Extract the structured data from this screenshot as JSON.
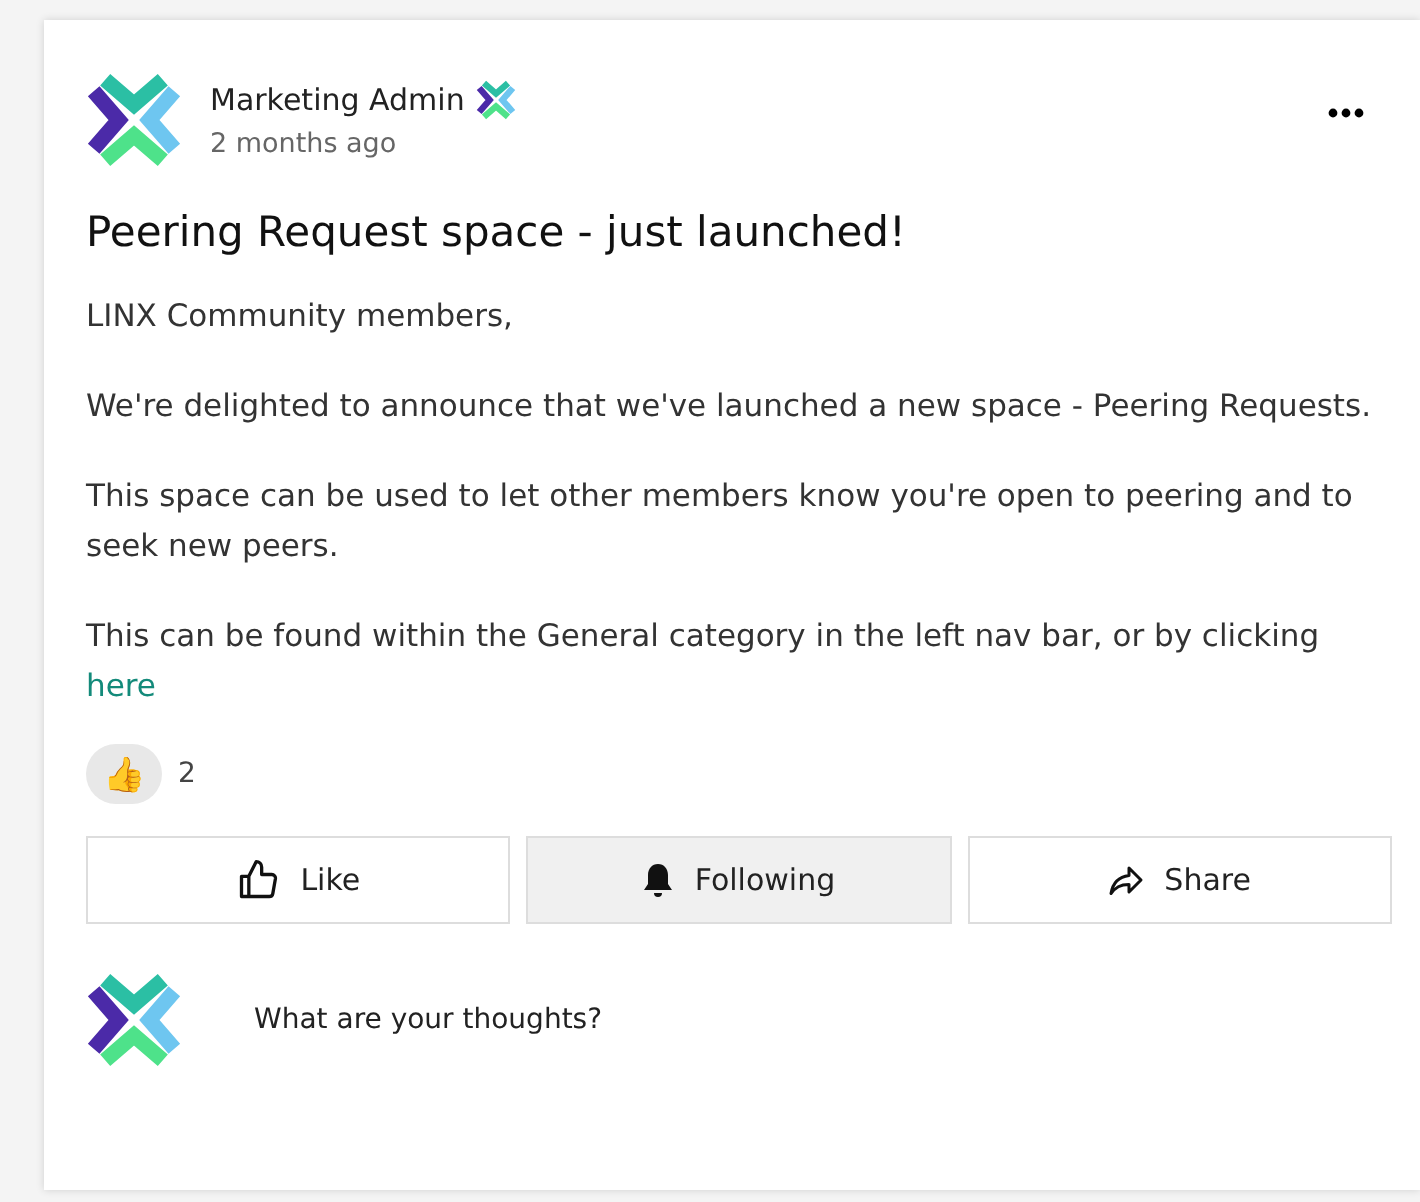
{
  "post": {
    "author": "Marketing Admin",
    "time": "2 months ago",
    "title": "Peering Request space - just launched!",
    "paragraphs": [
      {
        "text": "LINX Community members,"
      },
      {
        "text": "We're delighted to announce that we've launched a new space - Peering Requests."
      },
      {
        "text": "This space can be used to let other members know you're open to peering and to seek new peers."
      },
      {
        "text": "This can be found within the General category in the left nav bar, or by clicking",
        "link": "here"
      }
    ],
    "reactions": [
      {
        "emoji": "👍",
        "count": "2"
      }
    ],
    "actions": [
      {
        "kind": "like",
        "label": "Like",
        "selected": false
      },
      {
        "kind": "follow",
        "label": "Following",
        "selected": true
      },
      {
        "kind": "share",
        "label": "Share",
        "selected": false
      }
    ],
    "comment": {
      "placeholder": "What are your thoughts?"
    }
  }
}
